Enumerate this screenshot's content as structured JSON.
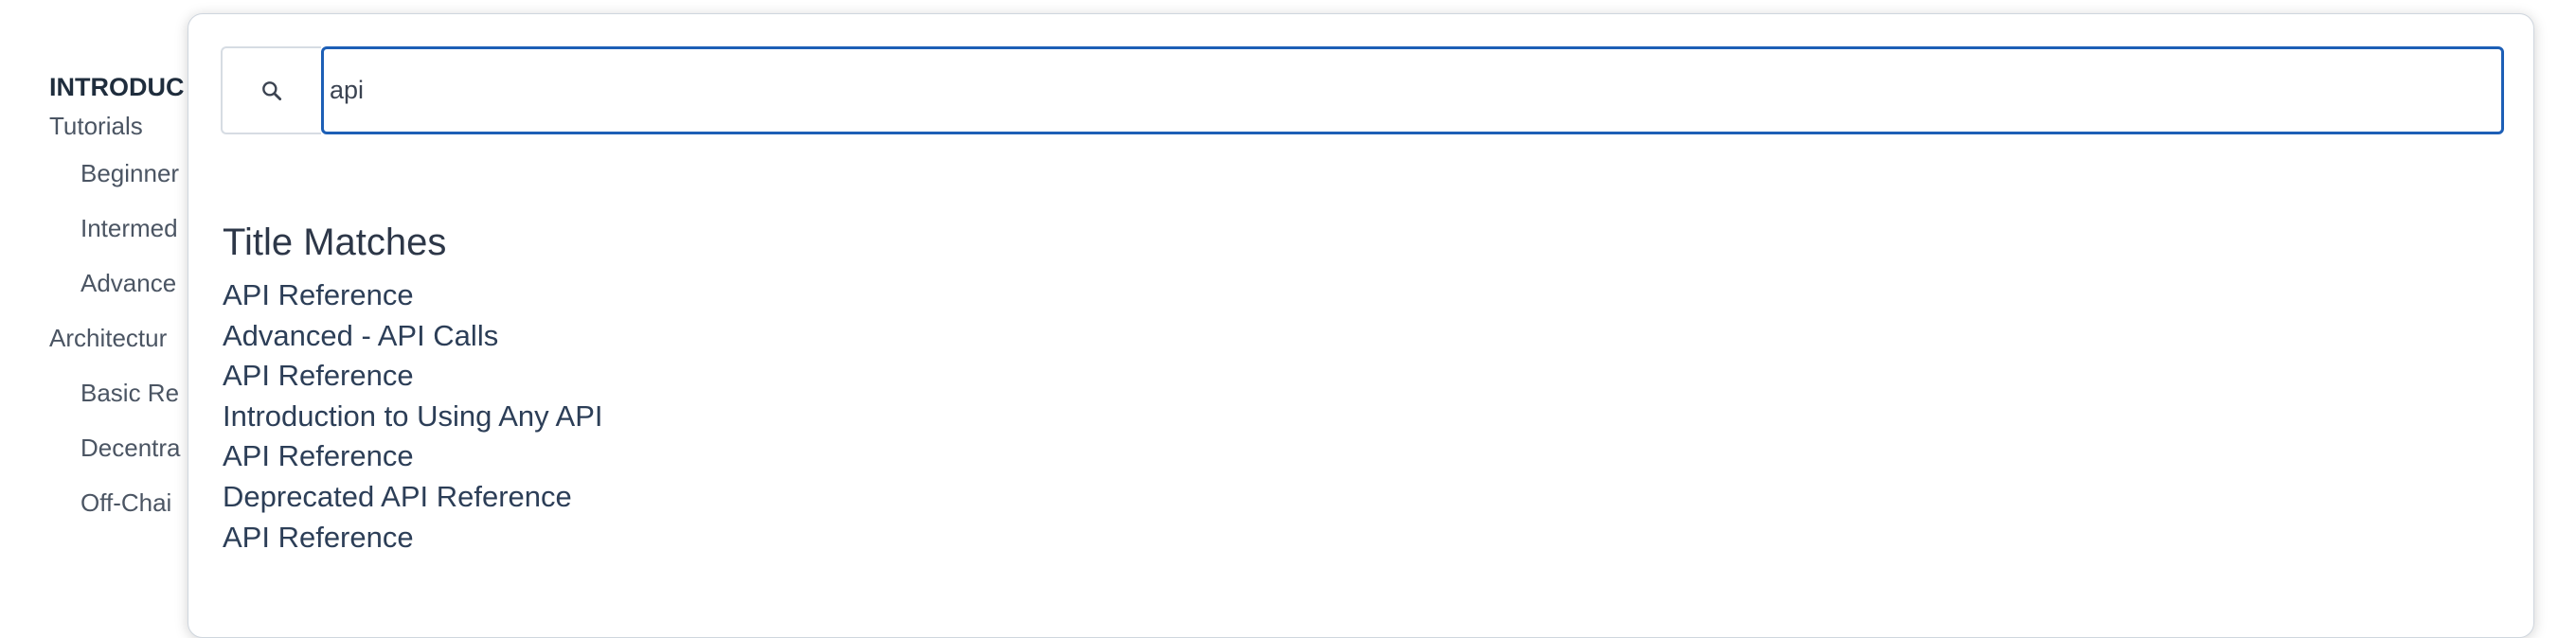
{
  "sidebar": {
    "heading": "INTRODUC",
    "items": [
      {
        "label": "Tutorials"
      },
      {
        "label": "Beginner"
      },
      {
        "label": "Intermed"
      },
      {
        "label": "Advance"
      },
      {
        "label": "Architectur"
      },
      {
        "label": "Basic Re"
      },
      {
        "label": "Decentra"
      },
      {
        "label": "Off-Chai"
      }
    ]
  },
  "search": {
    "icon": "search-icon",
    "value": "api",
    "focus_color": "#1d5fb6"
  },
  "results": {
    "heading": "Title Matches",
    "items": [
      {
        "label": "API Reference"
      },
      {
        "label": "Advanced - API Calls"
      },
      {
        "label": "API Reference"
      },
      {
        "label": "Introduction to Using Any API"
      },
      {
        "label": "API Reference"
      },
      {
        "label": "Deprecated API Reference"
      },
      {
        "label": "API Reference"
      }
    ]
  }
}
